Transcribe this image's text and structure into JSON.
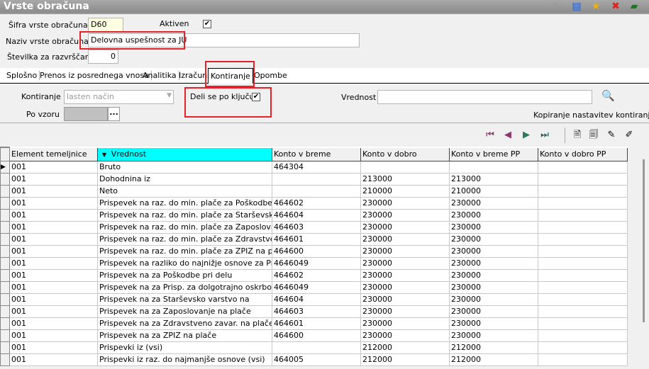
{
  "window": {
    "title": "Vrste obračuna",
    "icons": [
      "edit-icon",
      "window-list-icon",
      "favorite-star-icon",
      "delete-document-icon",
      "help-book-icon"
    ]
  },
  "form": {
    "code_label": "Šifra vrste obračuna",
    "code_value": "D60",
    "active_label": "Aktiven",
    "active_checked": true,
    "name_label": "Naziv vrste obračuna",
    "name_value": "Delovna uspešnost za JU",
    "sort_label": "Številka  za razvrščanje",
    "sort_value": "0"
  },
  "tabs": [
    {
      "label": "Splošno"
    },
    {
      "label": "Prenos iz posrednega vnosa"
    },
    {
      "label": "Analitika"
    },
    {
      "label": "Izračun"
    },
    {
      "label": "Kontiranje",
      "active": true
    },
    {
      "label": "Opombe"
    }
  ],
  "panel": {
    "kontiranje_label": "Kontiranje",
    "kontiranje_value": "lasten način",
    "split_label": "Deli se po ključu",
    "split_checked": true,
    "vrednost_label": "Vrednost",
    "vrednost_value": "",
    "template_label": "Po vzoru",
    "template_button": "...",
    "copy_link": "Kopiranje nastavitev kontiranja"
  },
  "grid": {
    "columns": [
      "Element temeljnice",
      "Vrednost",
      "Konto v breme",
      "Konto v dobro",
      "Konto v breme PP",
      "Konto v dobro PP"
    ],
    "sorted_column": 1,
    "rows": [
      [
        "001",
        "Bruto",
        "464304",
        "",
        "",
        ""
      ],
      [
        "001",
        "Dohodnina iz",
        "",
        "213000",
        "213000",
        ""
      ],
      [
        "001",
        "Neto",
        "",
        "210000",
        "210000",
        ""
      ],
      [
        "001",
        "Prispevek na raz. do min. plače za Poškodbe pri delu",
        "464602",
        "230000",
        "230000",
        ""
      ],
      [
        "001",
        "Prispevek na raz. do min. plače za Starševsko varstvo",
        "464604",
        "230000",
        "230000",
        ""
      ],
      [
        "001",
        "Prispevek na raz. do min. plače za Zaposlovanje na",
        "464603",
        "230000",
        "230000",
        ""
      ],
      [
        "001",
        "Prispevek na raz. do min. plače za Zdravstveno zav",
        "464601",
        "230000",
        "230000",
        ""
      ],
      [
        "001",
        "Prispevek na raz. do min. plače za ZPIZ na plače",
        "464600",
        "230000",
        "230000",
        ""
      ],
      [
        "001",
        "Prispevek na razliko do najnižje osnove za Prisp. za",
        "4646049",
        "230000",
        "230000",
        ""
      ],
      [
        "001",
        "Prispevek na za Poškodbe pri delu",
        "464602",
        "230000",
        "230000",
        ""
      ],
      [
        "001",
        "Prispevek na za Prisp. za dolgotrajno oskrbo",
        "4646049",
        "230000",
        "230000",
        ""
      ],
      [
        "001",
        "Prispevek na za Starševsko varstvo na",
        "464604",
        "230000",
        "230000",
        ""
      ],
      [
        "001",
        "Prispevek na za Zaposlovanje na plače",
        "464603",
        "230000",
        "230000",
        ""
      ],
      [
        "001",
        "Prispevek na za Zdravstveno zavar. na plače",
        "464601",
        "230000",
        "230000",
        ""
      ],
      [
        "001",
        "Prispevek na za ZPIZ na plače",
        "464600",
        "230000",
        "230000",
        ""
      ],
      [
        "001",
        "Prispevki iz (vsi)",
        "",
        "212000",
        "212000",
        ""
      ],
      [
        "001",
        "Prispevki iz raz. do najmanjše osnove (vsi)",
        "464005",
        "212000",
        "212000",
        ""
      ]
    ]
  },
  "colors": {
    "sorted_header": "#00ffff",
    "highlight": "#e8202a"
  }
}
